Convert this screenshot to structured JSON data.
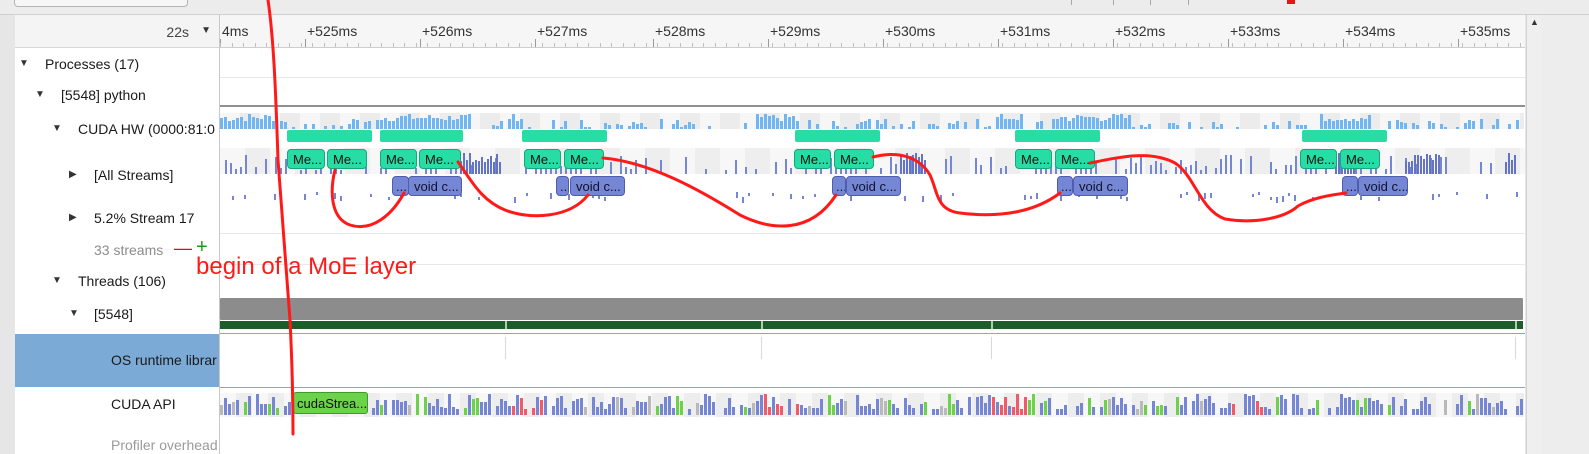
{
  "zoom": {
    "value": "22s"
  },
  "ruler": {
    "labels": [
      "4ms",
      "+525ms",
      "+526ms",
      "+527ms",
      "+528ms",
      "+529ms",
      "+530ms",
      "+531ms",
      "+532ms",
      "+533ms",
      "+534ms",
      "+535ms"
    ]
  },
  "tree": {
    "processes": "Processes (17)",
    "python": "[5548] python",
    "cuda_hw": "CUDA HW (0000:81:0",
    "all_streams": "[All Streams]",
    "stream17": "5.2% Stream 17",
    "streams_count": "33 streams",
    "threads": "Threads (106)",
    "thread5548": "[5548]",
    "os_runtime": "OS runtime librar",
    "cuda_api": "CUDA API",
    "profiler": "Profiler overhead"
  },
  "kernels": {
    "me_label": "Me...",
    "void_label": "void c...",
    "dots_label": "..."
  },
  "cuda_api_block": "cudaStrea...",
  "annotation": "begin of a MoE layer",
  "colors": {
    "teal": "#28dca5",
    "kernel_blue": "#7587d4",
    "memcpy_light_blue": "#6fb6f2",
    "selection": "#7baad6",
    "thread_gray": "#8a8a8a",
    "thread_green": "#1b5e2c",
    "annotation_red": "#ff1a1a",
    "api_green": "#6bd24a",
    "api_red": "#f25a6a"
  }
}
